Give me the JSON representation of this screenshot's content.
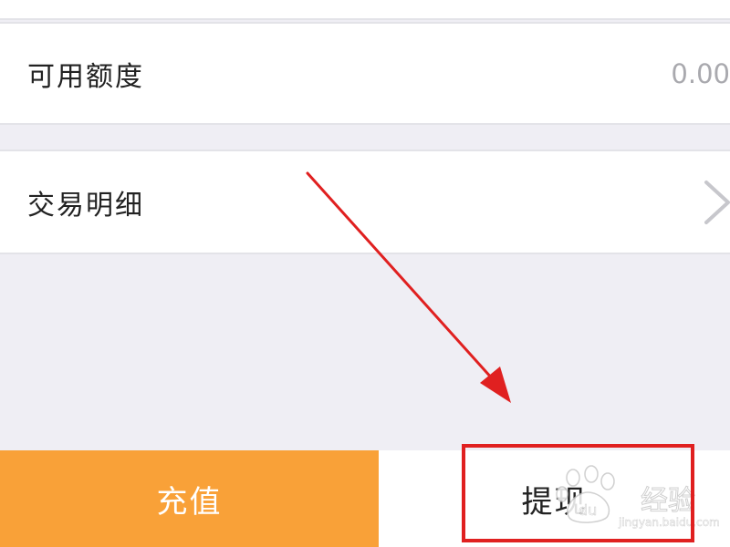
{
  "balance_row": {
    "label": "可用额度",
    "value": "0.00"
  },
  "detail_row": {
    "label": "交易明细",
    "chevron_icon": "chevron-right-icon"
  },
  "actions": {
    "recharge_label": "充值",
    "withdraw_label": "提现"
  },
  "watermark": {
    "text": "经验",
    "url": "jingyan.baidu.com",
    "logo_text": "du"
  },
  "colors": {
    "recharge_bg": "#f9a138",
    "highlight": "#e02020",
    "arrow": "#e02020",
    "page_bg": "#efeef4"
  }
}
